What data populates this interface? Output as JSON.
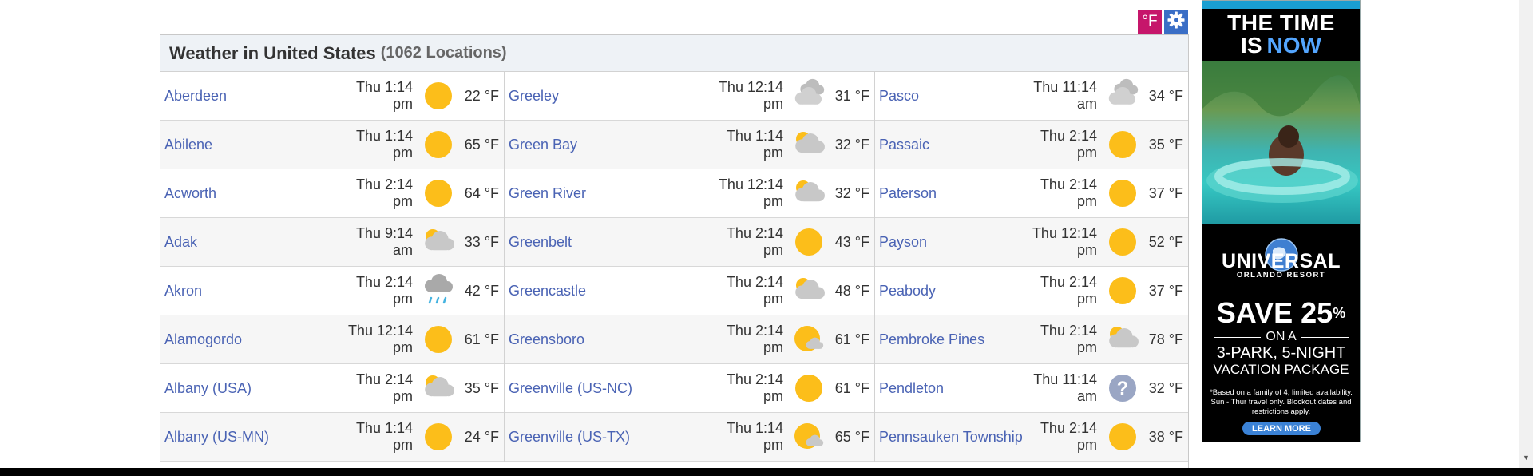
{
  "toolbar": {
    "unit_label": "°F",
    "settings_icon": "gear-icon"
  },
  "header": {
    "title": "Weather in United States",
    "count": "(1062 Locations)"
  },
  "columns": [
    [
      {
        "city": "Aberdeen",
        "time1": "Thu 1:14",
        "time2": "pm",
        "icon": "sun",
        "temp": "22 °F"
      },
      {
        "city": "Abilene",
        "time1": "Thu 1:14",
        "time2": "pm",
        "icon": "sun",
        "temp": "65 °F"
      },
      {
        "city": "Acworth",
        "time1": "Thu 2:14",
        "time2": "pm",
        "icon": "sun",
        "temp": "64 °F"
      },
      {
        "city": "Adak",
        "time1": "Thu 9:14",
        "time2": "am",
        "icon": "partly-cloudy",
        "temp": "33 °F"
      },
      {
        "city": "Akron",
        "time1": "Thu 2:14",
        "time2": "pm",
        "icon": "rain",
        "temp": "42 °F"
      },
      {
        "city": "Alamogordo",
        "time1": "Thu 12:14",
        "time2": "pm",
        "icon": "sun",
        "temp": "61 °F"
      },
      {
        "city": "Albany (USA)",
        "time1": "Thu 2:14",
        "time2": "pm",
        "icon": "partly-cloudy",
        "temp": "35 °F"
      },
      {
        "city": "Albany (US-MN)",
        "time1": "Thu 1:14",
        "time2": "pm",
        "icon": "sun",
        "temp": "24 °F"
      }
    ],
    [
      {
        "city": "Greeley",
        "time1": "Thu 12:14",
        "time2": "pm",
        "icon": "cloudy",
        "temp": "31 °F"
      },
      {
        "city": "Green Bay",
        "time1": "Thu 1:14",
        "time2": "pm",
        "icon": "partly-cloudy",
        "temp": "32 °F"
      },
      {
        "city": "Green River",
        "time1": "Thu 12:14",
        "time2": "pm",
        "icon": "partly-cloudy",
        "temp": "32 °F"
      },
      {
        "city": "Greenbelt",
        "time1": "Thu 2:14",
        "time2": "pm",
        "icon": "sun",
        "temp": "43 °F"
      },
      {
        "city": "Greencastle",
        "time1": "Thu 2:14",
        "time2": "pm",
        "icon": "partly-cloudy",
        "temp": "48 °F"
      },
      {
        "city": "Greensboro",
        "time1": "Thu 2:14",
        "time2": "pm",
        "icon": "sun-small-cloud",
        "temp": "61 °F"
      },
      {
        "city": "Greenville (US-NC)",
        "time1": "Thu 2:14",
        "time2": "pm",
        "icon": "sun",
        "temp": "61 °F"
      },
      {
        "city": "Greenville (US-TX)",
        "time1": "Thu 1:14",
        "time2": "pm",
        "icon": "sun-small-cloud",
        "temp": "65 °F"
      }
    ],
    [
      {
        "city": "Pasco",
        "time1": "Thu 11:14",
        "time2": "am",
        "icon": "cloudy",
        "temp": "34 °F"
      },
      {
        "city": "Passaic",
        "time1": "Thu 2:14",
        "time2": "pm",
        "icon": "sun",
        "temp": "35 °F"
      },
      {
        "city": "Paterson",
        "time1": "Thu 2:14",
        "time2": "pm",
        "icon": "sun",
        "temp": "37 °F"
      },
      {
        "city": "Payson",
        "time1": "Thu 12:14",
        "time2": "pm",
        "icon": "sun",
        "temp": "52 °F"
      },
      {
        "city": "Peabody",
        "time1": "Thu 2:14",
        "time2": "pm",
        "icon": "sun",
        "temp": "37 °F"
      },
      {
        "city": "Pembroke Pines",
        "time1": "Thu 2:14",
        "time2": "pm",
        "icon": "partly-cloudy",
        "temp": "78 °F"
      },
      {
        "city": "Pendleton",
        "time1": "Thu 11:14",
        "time2": "am",
        "icon": "unknown",
        "temp": "32 °F"
      },
      {
        "city": "Pennsauken Township",
        "time1": "Thu 2:14",
        "time2": "pm",
        "icon": "sun",
        "temp": "38 °F"
      }
    ]
  ],
  "ad": {
    "line1": "THE TIME",
    "line2_is": "IS",
    "line2_now": "NOW",
    "brand": "UNIVERSAL",
    "brand_sub": "ORLANDO RESORT",
    "save": "SAVE 25",
    "save_pct": "%",
    "on_a": "ON A",
    "park": "3-PARK, 5-NIGHT",
    "vacation": "VACATION PACKAGE",
    "fine_print": "*Based on a family of 4, limited availability. Sun - Thur travel only. Blockout dates and restrictions apply.",
    "learn_more": "LEARN MORE"
  },
  "colors": {
    "link": "#4a63b4",
    "unit_button": "#c6166b",
    "settings_button": "#3a6ec6",
    "sun": "#fcbe1a",
    "cloud": "#c8c8c8"
  }
}
